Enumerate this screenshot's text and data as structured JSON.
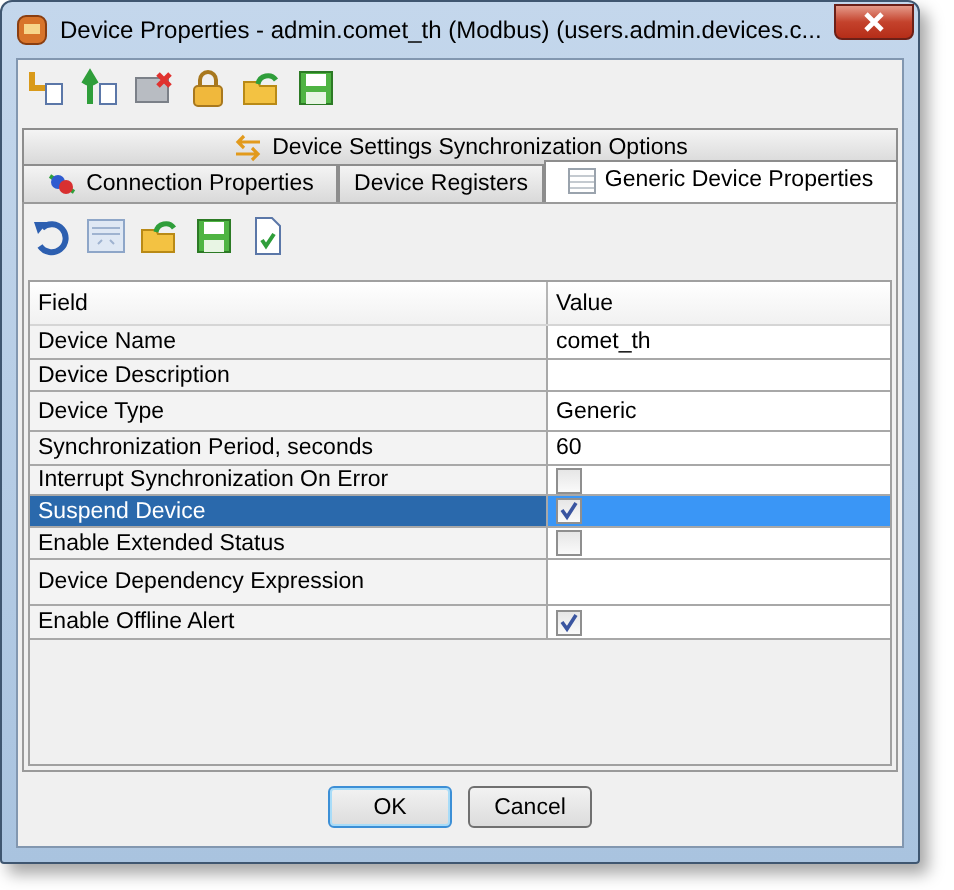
{
  "window": {
    "title": "Device Properties - admin.comet_th (Modbus) (users.admin.devices.c..."
  },
  "tabs_top": [
    {
      "label": "Device Settings Synchronization Options",
      "selected": false
    }
  ],
  "tabs": [
    {
      "label": "Connection Properties",
      "selected": false
    },
    {
      "label": "Device Registers",
      "selected": false
    },
    {
      "label": "Generic Device Properties",
      "selected": true
    }
  ],
  "table": {
    "columns": [
      "Field",
      "Value"
    ],
    "rows": [
      {
        "field": "Device Name",
        "kind": "text",
        "value": "comet_th",
        "selected": false
      },
      {
        "field": "Device Description",
        "kind": "text",
        "selected": false
      },
      {
        "field": "Device Type",
        "kind": "text",
        "value": "Generic",
        "selected": false
      },
      {
        "field": "Synchronization Period, seconds",
        "kind": "text",
        "value": "60",
        "selected": false
      },
      {
        "field": "Interrupt Synchronization On Error",
        "kind": "checkbox",
        "checked": false,
        "selected": false
      },
      {
        "field": "Suspend Device",
        "kind": "checkbox",
        "checked": true,
        "selected": true
      },
      {
        "field": "Enable Extended Status",
        "kind": "checkbox",
        "checked": false,
        "selected": false
      },
      {
        "field": "Device Dependency Expression",
        "kind": "text",
        "selected": false
      },
      {
        "field": "Enable Offline Alert",
        "kind": "checkbox",
        "checked": true,
        "selected": false
      }
    ]
  },
  "buttons": [
    {
      "label": "OK",
      "default": true
    },
    {
      "label": "Cancel",
      "default": false
    }
  ]
}
